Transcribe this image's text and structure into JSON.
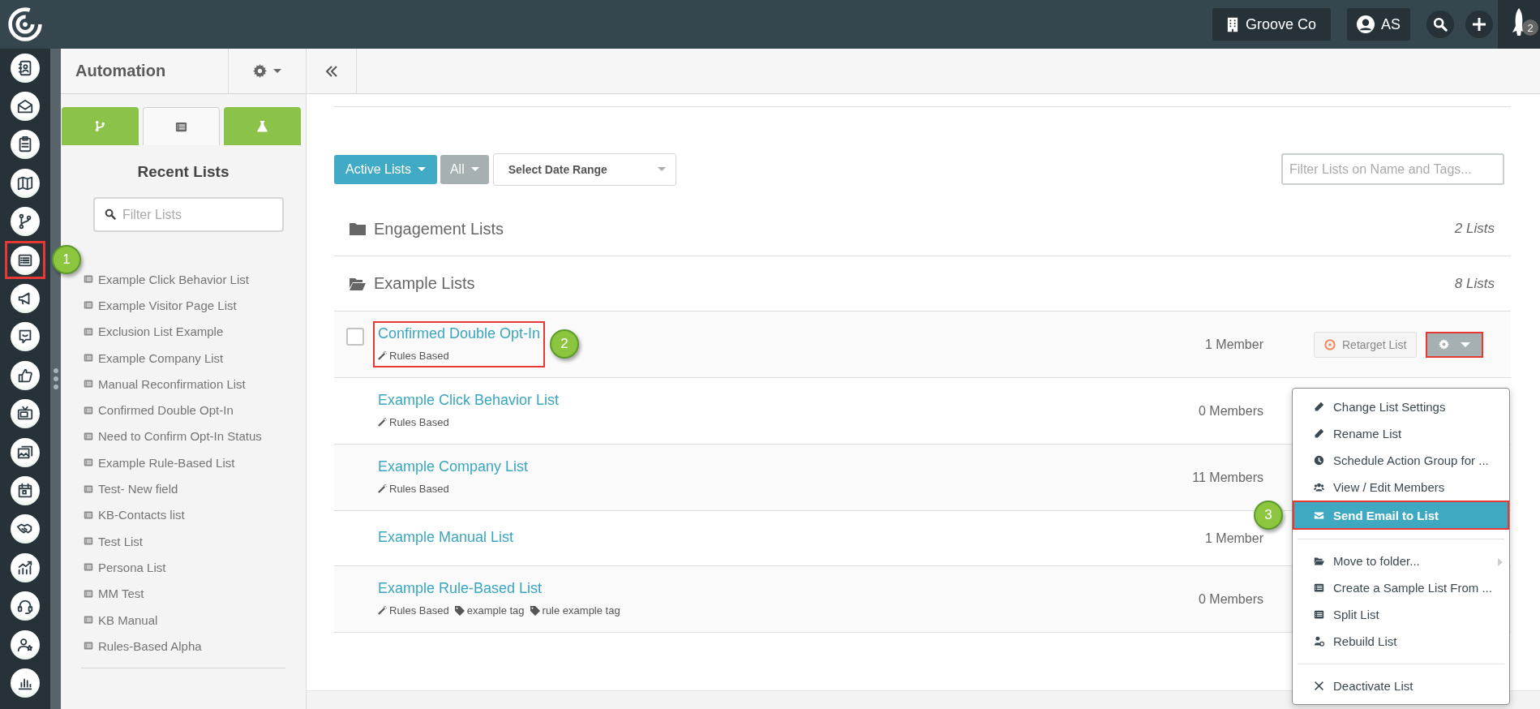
{
  "topbar": {
    "org": "Groove Co",
    "user": "AS",
    "notifications": "2"
  },
  "rail": [
    {
      "highlighted": false
    },
    {
      "highlighted": false
    },
    {
      "highlighted": false
    },
    {
      "highlighted": false
    },
    {
      "highlighted": false
    },
    {
      "highlighted": true,
      "callout": "1"
    },
    {
      "highlighted": false
    },
    {
      "highlighted": false
    },
    {
      "highlighted": false
    },
    {
      "highlighted": false
    },
    {
      "highlighted": false
    },
    {
      "highlighted": false
    },
    {
      "highlighted": false
    },
    {
      "highlighted": false
    },
    {
      "highlighted": false
    },
    {
      "highlighted": false
    },
    {
      "highlighted": false
    }
  ],
  "panel": {
    "title": "Automation",
    "tabs": [
      {
        "selected": false
      },
      {
        "selected": true
      },
      {
        "selected": false
      }
    ],
    "heading": "Recent Lists",
    "filter": {
      "placeholder": "Filter Lists"
    },
    "items": [
      "Example Click Behavior List",
      "Example Visitor Page List",
      "Exclusion List Example",
      "Example Company List",
      "Manual Reconfirmation List",
      "Confirmed Double Opt-In",
      "Need to Confirm Opt-In Status",
      "Example Rule-Based List",
      "Test- New field",
      "KB-Contacts list",
      "Test List",
      "Persona List",
      "MM Test",
      "KB Manual",
      "Rules-Based Alpha"
    ]
  },
  "main": {
    "toolbar": {
      "status": "Active Lists",
      "scope": "All",
      "date_range": "Select Date Range",
      "filter": {
        "placeholder": "Filter Lists on Name and Tags..."
      }
    },
    "folders": [
      {
        "name": "Engagement Lists",
        "count": "2 Lists",
        "open": false
      },
      {
        "name": "Example Lists",
        "count": "8 Lists",
        "open": true
      }
    ],
    "rows": [
      {
        "name": "Confirmed Double Opt-In",
        "tags": [
          {
            "kind": "rules",
            "text": "Rules Based"
          }
        ],
        "members": "1 Member",
        "highlighted": true,
        "callout": "2",
        "checkbox": {
          "checked": false
        },
        "actions": {
          "retarget": "Retarget List",
          "gear_highlighted": true
        }
      },
      {
        "name": "Example Click Behavior List",
        "tags": [
          {
            "kind": "rules",
            "text": "Rules Based"
          }
        ],
        "members": "0 Members",
        "highlighted": false
      },
      {
        "name": "Example Company List",
        "tags": [
          {
            "kind": "rules",
            "text": "Rules Based"
          }
        ],
        "members": "11 Members",
        "highlighted": false
      },
      {
        "name": "Example Manual List",
        "members": "1 Member",
        "highlighted": false
      },
      {
        "name": "Example Rule-Based List",
        "tags": [
          {
            "kind": "rules",
            "text": "Rules Based"
          },
          {
            "kind": "tag",
            "text": "example tag"
          },
          {
            "kind": "tag",
            "text": "rule example tag"
          }
        ],
        "members": "0 Members",
        "highlighted": false
      }
    ]
  },
  "menu": {
    "items": [
      {
        "kind": "item",
        "label": "Change List Settings",
        "selected": false,
        "highlighted": false,
        "submenu": false
      },
      {
        "kind": "item",
        "label": "Rename List",
        "selected": false,
        "highlighted": false,
        "submenu": false
      },
      {
        "kind": "item",
        "label": "Schedule Action Group for ...",
        "selected": false,
        "highlighted": false,
        "submenu": false
      },
      {
        "kind": "item",
        "label": "View / Edit Members",
        "selected": false,
        "highlighted": false,
        "submenu": false
      },
      {
        "kind": "item",
        "label": "Send Email to List",
        "selected": true,
        "highlighted": true,
        "submenu": false,
        "callout": "3"
      },
      {
        "kind": "divider"
      },
      {
        "kind": "item",
        "label": "Move to folder...",
        "selected": false,
        "highlighted": false,
        "submenu": true
      },
      {
        "kind": "item",
        "label": "Create a Sample List From ...",
        "selected": false,
        "highlighted": false,
        "submenu": false
      },
      {
        "kind": "item",
        "label": "Split List",
        "selected": false,
        "highlighted": false,
        "submenu": false
      },
      {
        "kind": "item",
        "label": "Rebuild List",
        "selected": false,
        "highlighted": false,
        "submenu": false
      },
      {
        "kind": "divider"
      },
      {
        "kind": "item",
        "label": "Deactivate List",
        "selected": false,
        "highlighted": false,
        "submenu": false
      }
    ]
  }
}
